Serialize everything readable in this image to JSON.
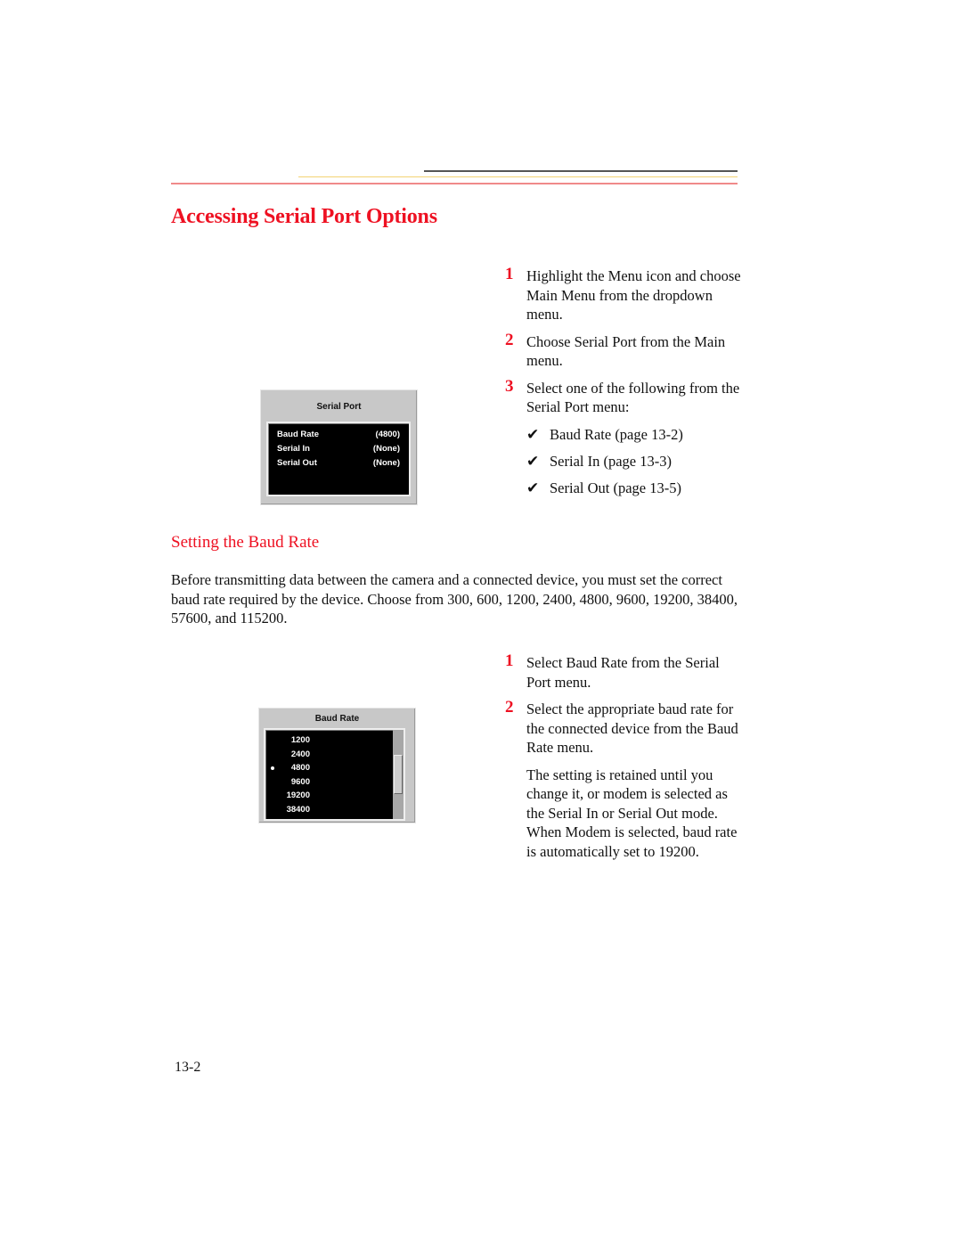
{
  "page": {
    "title": "Accessing Serial Port Options",
    "page_number": "13-2",
    "accent_color": "#ee1122"
  },
  "section1": {
    "steps": [
      {
        "num": "1",
        "text": "Highlight the Menu icon and choose Main Menu from the dropdown menu."
      },
      {
        "num": "2",
        "text": "Choose Serial Port from the Main menu."
      },
      {
        "num": "3",
        "text": "Select one of the following from the Serial Port menu:"
      }
    ],
    "options": [
      {
        "icon": "check-icon",
        "glyph": "✔",
        "text": "Baud Rate (page 13-2)"
      },
      {
        "icon": "check-icon",
        "glyph": "✔",
        "text": "Serial In (page 13-3)"
      },
      {
        "icon": "check-icon",
        "glyph": "✔",
        "text": "Serial Out (page 13-5)"
      }
    ]
  },
  "serial_port_menu": {
    "title": "Serial Port",
    "rows": [
      {
        "label": "Baud Rate",
        "value": "(4800)"
      },
      {
        "label": "Serial In",
        "value": "(None)"
      },
      {
        "label": "Serial Out",
        "value": "(None)"
      }
    ]
  },
  "section2": {
    "heading": "Setting the Baud Rate",
    "intro": "Before transmitting data between the camera and a connected device, you must set the correct baud rate required by the device. Choose from 300, 600, 1200, 2400, 4800, 9600, 19200, 38400, 57600, and 115200.",
    "steps": [
      {
        "num": "1",
        "text": "Select Baud Rate from the Serial Port menu."
      },
      {
        "num": "2",
        "text": "Select the appropriate baud rate for the connected device from the Baud Rate menu."
      }
    ],
    "note": "The setting is retained until you change it, or modem is selected as the Serial In or Serial Out mode. When Modem is selected, baud rate is automatically set to 19200."
  },
  "baud_rate_menu": {
    "title": "Baud Rate",
    "selected": "4800",
    "items": [
      "1200",
      "2400",
      "4800",
      "9600",
      "19200",
      "38400"
    ]
  }
}
